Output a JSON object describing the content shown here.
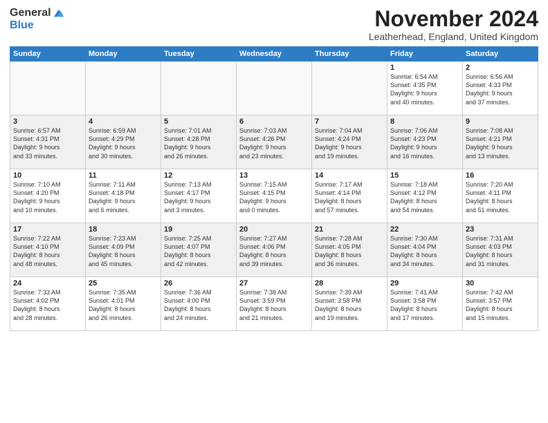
{
  "logo": {
    "general": "General",
    "blue": "Blue"
  },
  "title": "November 2024",
  "location": "Leatherhead, England, United Kingdom",
  "days_of_week": [
    "Sunday",
    "Monday",
    "Tuesday",
    "Wednesday",
    "Thursday",
    "Friday",
    "Saturday"
  ],
  "weeks": [
    [
      {
        "day": "",
        "info": ""
      },
      {
        "day": "",
        "info": ""
      },
      {
        "day": "",
        "info": ""
      },
      {
        "day": "",
        "info": ""
      },
      {
        "day": "",
        "info": ""
      },
      {
        "day": "1",
        "info": "Sunrise: 6:54 AM\nSunset: 4:35 PM\nDaylight: 9 hours\nand 40 minutes."
      },
      {
        "day": "2",
        "info": "Sunrise: 6:56 AM\nSunset: 4:33 PM\nDaylight: 9 hours\nand 37 minutes."
      }
    ],
    [
      {
        "day": "3",
        "info": "Sunrise: 6:57 AM\nSunset: 4:31 PM\nDaylight: 9 hours\nand 33 minutes."
      },
      {
        "day": "4",
        "info": "Sunrise: 6:59 AM\nSunset: 4:29 PM\nDaylight: 9 hours\nand 30 minutes."
      },
      {
        "day": "5",
        "info": "Sunrise: 7:01 AM\nSunset: 4:28 PM\nDaylight: 9 hours\nand 26 minutes."
      },
      {
        "day": "6",
        "info": "Sunrise: 7:03 AM\nSunset: 4:26 PM\nDaylight: 9 hours\nand 23 minutes."
      },
      {
        "day": "7",
        "info": "Sunrise: 7:04 AM\nSunset: 4:24 PM\nDaylight: 9 hours\nand 19 minutes."
      },
      {
        "day": "8",
        "info": "Sunrise: 7:06 AM\nSunset: 4:23 PM\nDaylight: 9 hours\nand 16 minutes."
      },
      {
        "day": "9",
        "info": "Sunrise: 7:08 AM\nSunset: 4:21 PM\nDaylight: 9 hours\nand 13 minutes."
      }
    ],
    [
      {
        "day": "10",
        "info": "Sunrise: 7:10 AM\nSunset: 4:20 PM\nDaylight: 9 hours\nand 10 minutes."
      },
      {
        "day": "11",
        "info": "Sunrise: 7:11 AM\nSunset: 4:18 PM\nDaylight: 9 hours\nand 6 minutes."
      },
      {
        "day": "12",
        "info": "Sunrise: 7:13 AM\nSunset: 4:17 PM\nDaylight: 9 hours\nand 3 minutes."
      },
      {
        "day": "13",
        "info": "Sunrise: 7:15 AM\nSunset: 4:15 PM\nDaylight: 9 hours\nand 0 minutes."
      },
      {
        "day": "14",
        "info": "Sunrise: 7:17 AM\nSunset: 4:14 PM\nDaylight: 8 hours\nand 57 minutes."
      },
      {
        "day": "15",
        "info": "Sunrise: 7:18 AM\nSunset: 4:12 PM\nDaylight: 8 hours\nand 54 minutes."
      },
      {
        "day": "16",
        "info": "Sunrise: 7:20 AM\nSunset: 4:11 PM\nDaylight: 8 hours\nand 51 minutes."
      }
    ],
    [
      {
        "day": "17",
        "info": "Sunrise: 7:22 AM\nSunset: 4:10 PM\nDaylight: 8 hours\nand 48 minutes."
      },
      {
        "day": "18",
        "info": "Sunrise: 7:23 AM\nSunset: 4:09 PM\nDaylight: 8 hours\nand 45 minutes."
      },
      {
        "day": "19",
        "info": "Sunrise: 7:25 AM\nSunset: 4:07 PM\nDaylight: 8 hours\nand 42 minutes."
      },
      {
        "day": "20",
        "info": "Sunrise: 7:27 AM\nSunset: 4:06 PM\nDaylight: 8 hours\nand 39 minutes."
      },
      {
        "day": "21",
        "info": "Sunrise: 7:28 AM\nSunset: 4:05 PM\nDaylight: 8 hours\nand 36 minutes."
      },
      {
        "day": "22",
        "info": "Sunrise: 7:30 AM\nSunset: 4:04 PM\nDaylight: 8 hours\nand 34 minutes."
      },
      {
        "day": "23",
        "info": "Sunrise: 7:31 AM\nSunset: 4:03 PM\nDaylight: 8 hours\nand 31 minutes."
      }
    ],
    [
      {
        "day": "24",
        "info": "Sunrise: 7:33 AM\nSunset: 4:02 PM\nDaylight: 8 hours\nand 28 minutes."
      },
      {
        "day": "25",
        "info": "Sunrise: 7:35 AM\nSunset: 4:01 PM\nDaylight: 8 hours\nand 26 minutes."
      },
      {
        "day": "26",
        "info": "Sunrise: 7:36 AM\nSunset: 4:00 PM\nDaylight: 8 hours\nand 24 minutes."
      },
      {
        "day": "27",
        "info": "Sunrise: 7:38 AM\nSunset: 3:59 PM\nDaylight: 8 hours\nand 21 minutes."
      },
      {
        "day": "28",
        "info": "Sunrise: 7:39 AM\nSunset: 3:58 PM\nDaylight: 8 hours\nand 19 minutes."
      },
      {
        "day": "29",
        "info": "Sunrise: 7:41 AM\nSunset: 3:58 PM\nDaylight: 8 hours\nand 17 minutes."
      },
      {
        "day": "30",
        "info": "Sunrise: 7:42 AM\nSunset: 3:57 PM\nDaylight: 8 hours\nand 15 minutes."
      }
    ]
  ]
}
